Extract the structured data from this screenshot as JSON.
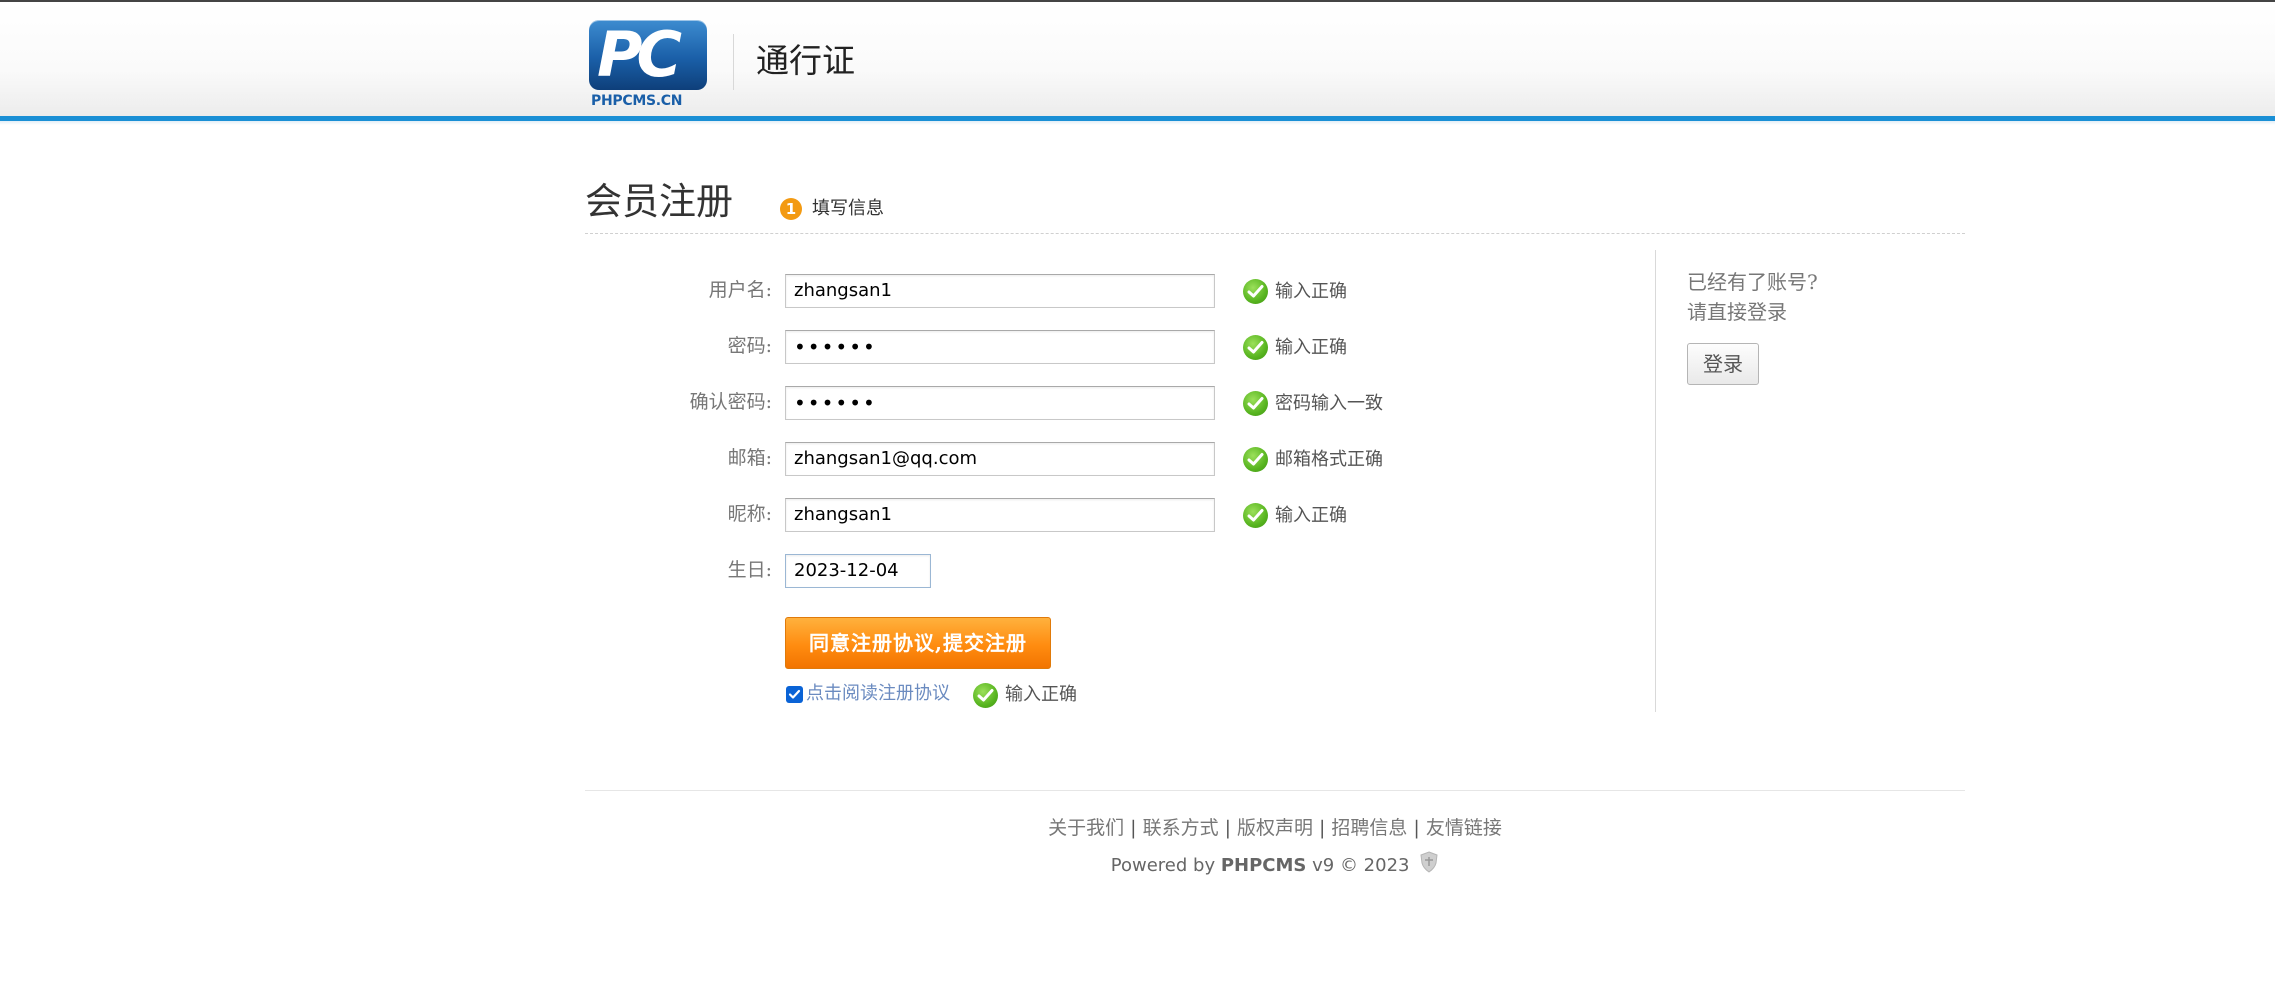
{
  "header": {
    "logo_letters": "PC",
    "logo_text": "PHPCMS.CN",
    "site_name": "通行证"
  },
  "page": {
    "title": "会员注册",
    "step_number": "1",
    "step_label": "填写信息"
  },
  "form": {
    "username": {
      "label": "用户名:",
      "value": "zhangsan1",
      "message": "输入正确"
    },
    "password": {
      "label": "密码:",
      "value": "••••••",
      "message": "输入正确"
    },
    "confirm_password": {
      "label": "确认密码:",
      "value": "••••••",
      "message": "密码输入一致"
    },
    "email": {
      "label": "邮箱:",
      "value": "zhangsan1@qq.com",
      "message": "邮箱格式正确"
    },
    "nickname": {
      "label": "昵称:",
      "value": "zhangsan1",
      "message": "输入正确"
    },
    "birthday": {
      "label": "生日:",
      "value": "2023-12-04"
    },
    "submit_label": "同意注册协议,提交注册",
    "agree_checked": true,
    "agree_label": "点击阅读注册协议",
    "agree_message": "输入正确"
  },
  "sidebar": {
    "line1": "已经有了账号?",
    "line2": "请直接登录",
    "login_label": "登录"
  },
  "footer": {
    "links": [
      "关于我们",
      "联系方式",
      "版权声明",
      "招聘信息",
      "友情链接"
    ],
    "separator": "|",
    "powered_prefix": "Powered by",
    "powered_brand": "PHPCMS",
    "powered_suffix": "v9 © 2023"
  },
  "colors": {
    "accent_blue": "#1a8fd5",
    "submit_orange": "#ff8c10",
    "success_green": "#58b520"
  }
}
